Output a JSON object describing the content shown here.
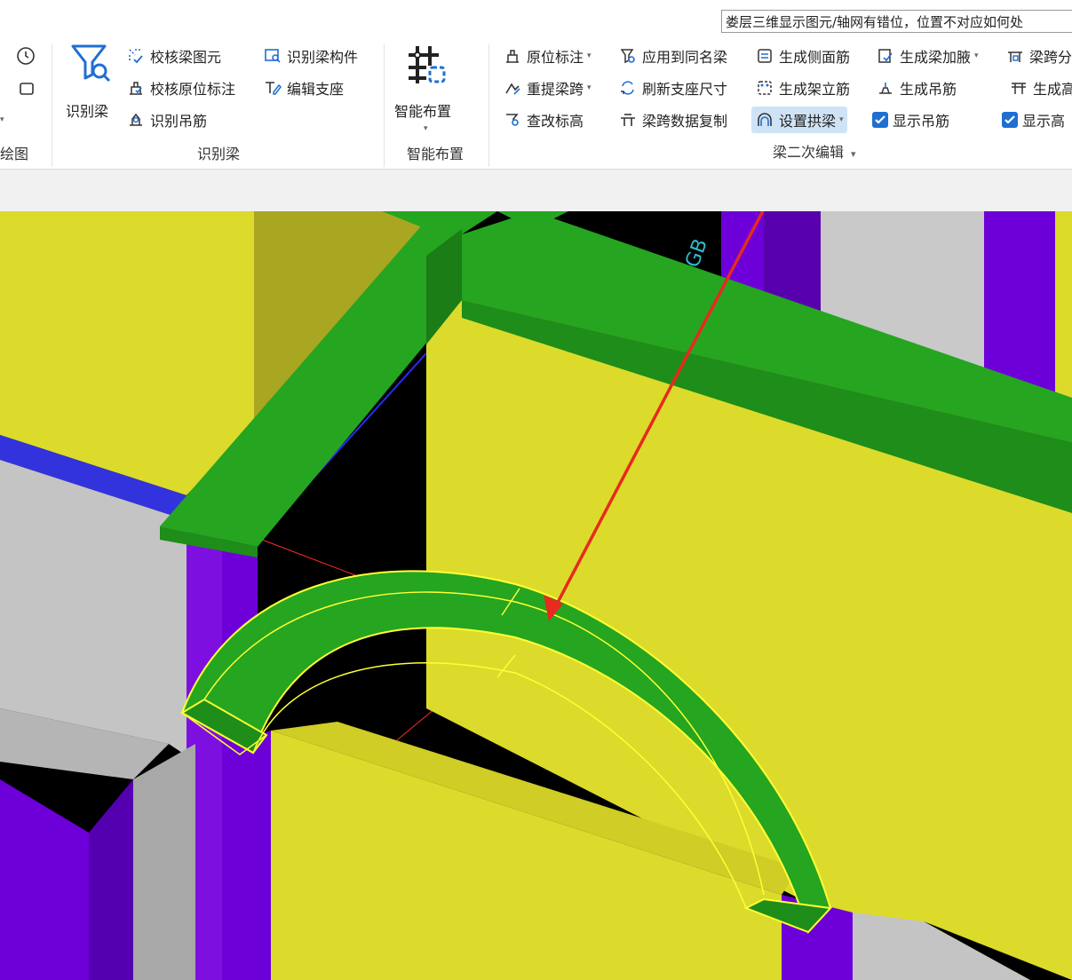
{
  "search": {
    "text": "娄层三维显示图元/轴网有错位，位置不对应如何处"
  },
  "ribbon": {
    "partial_group_label": "绘图",
    "identify_group": {
      "label": "识别梁",
      "big_button": "识别梁",
      "items": [
        "校核梁图元",
        "识别梁构件",
        "校核原位标注",
        "编辑支座",
        "识别吊筋"
      ]
    },
    "smart_group": {
      "label": "智能布置",
      "big_button": "智能布置"
    },
    "edit_group": {
      "label": "梁二次编辑",
      "col1": [
        "原位标注",
        "重提梁跨",
        "查改标高"
      ],
      "col2": [
        "应用到同名梁",
        "刷新支座尺寸",
        "梁跨数据复制"
      ],
      "col3": [
        "生成侧面筋",
        "生成架立筋",
        "设置拱梁"
      ],
      "col4": [
        "生成梁加腋",
        "生成吊筋",
        "显示吊筋"
      ],
      "col5": [
        "梁跨分",
        "生成高",
        "显示高"
      ]
    }
  },
  "viewport": {
    "annotation_text": "GB"
  },
  "colors": {
    "beam_green": "#25a520",
    "wall_yellow": "#dcdb2b",
    "column_purple": "#6d00d8",
    "arrow_red": "#e8291f",
    "accent_blue": "#1f6fd1"
  }
}
